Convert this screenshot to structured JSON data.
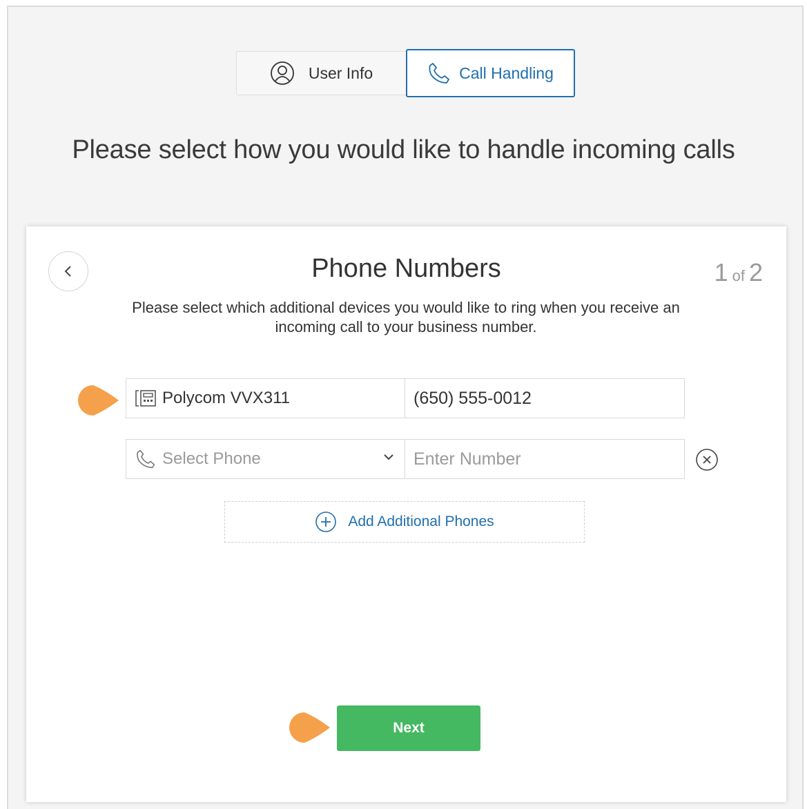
{
  "tabs": [
    {
      "label": "User Info",
      "icon": "user-icon",
      "active": false
    },
    {
      "label": "Call Handling",
      "icon": "phone-icon",
      "active": true
    }
  ],
  "heading": "Please select how you would like to handle incoming calls",
  "card": {
    "title": "Phone Numbers",
    "step_current": "1",
    "step_of": "of",
    "step_total": "2",
    "description": "Please select which additional devices you would like to ring when you receive an incoming call to your business number."
  },
  "phones": [
    {
      "device": "Polycom VVX311",
      "device_icon": "desk-phone-icon",
      "number": "(650) 555-0012"
    }
  ],
  "new_phone": {
    "select_placeholder": "Select Phone",
    "number_placeholder": "Enter Number",
    "select_icon": "phone-icon",
    "caret_icon": "chevron-down-icon",
    "remove_icon": "close-circle-icon"
  },
  "add_button_label": "Add Additional Phones",
  "next_label": "Next",
  "colors": {
    "accent_blue": "#1f6fae",
    "next_green": "#45b862",
    "callout_orange": "#f5a04a",
    "page_background": "#f4f4f4"
  }
}
